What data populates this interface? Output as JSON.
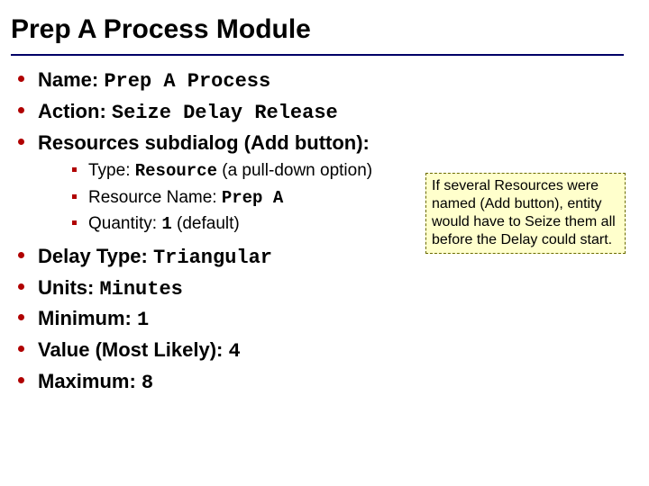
{
  "title": "Prep A Process Module",
  "bullets": {
    "name": {
      "label": "Name: ",
      "value": "Prep A Process"
    },
    "action": {
      "label": "Action: ",
      "value": "Seize Delay Release"
    },
    "resources": {
      "label": "Resources subdialog (Add button):"
    },
    "delay_type": {
      "label": "Delay Type: ",
      "value": "Triangular"
    },
    "units": {
      "label": "Units: ",
      "value": "Minutes"
    },
    "minimum": {
      "label": "Minimum: ",
      "value": "1"
    },
    "most_likely": {
      "label": "Value (Most Likely): ",
      "value": "4"
    },
    "maximum": {
      "label": "Maximum: ",
      "value": "8"
    }
  },
  "sub": {
    "type": {
      "pre": "Type: ",
      "code": "Resource",
      "post": " (a pull-down option)"
    },
    "resname": {
      "pre": "Resource Name: ",
      "code": "Prep A",
      "post": ""
    },
    "qty": {
      "pre": "Quantity: ",
      "code": "1",
      "post": " (default)"
    }
  },
  "callout": "If several Resources were named (Add button), entity would have to Seize them all before the Delay could start."
}
